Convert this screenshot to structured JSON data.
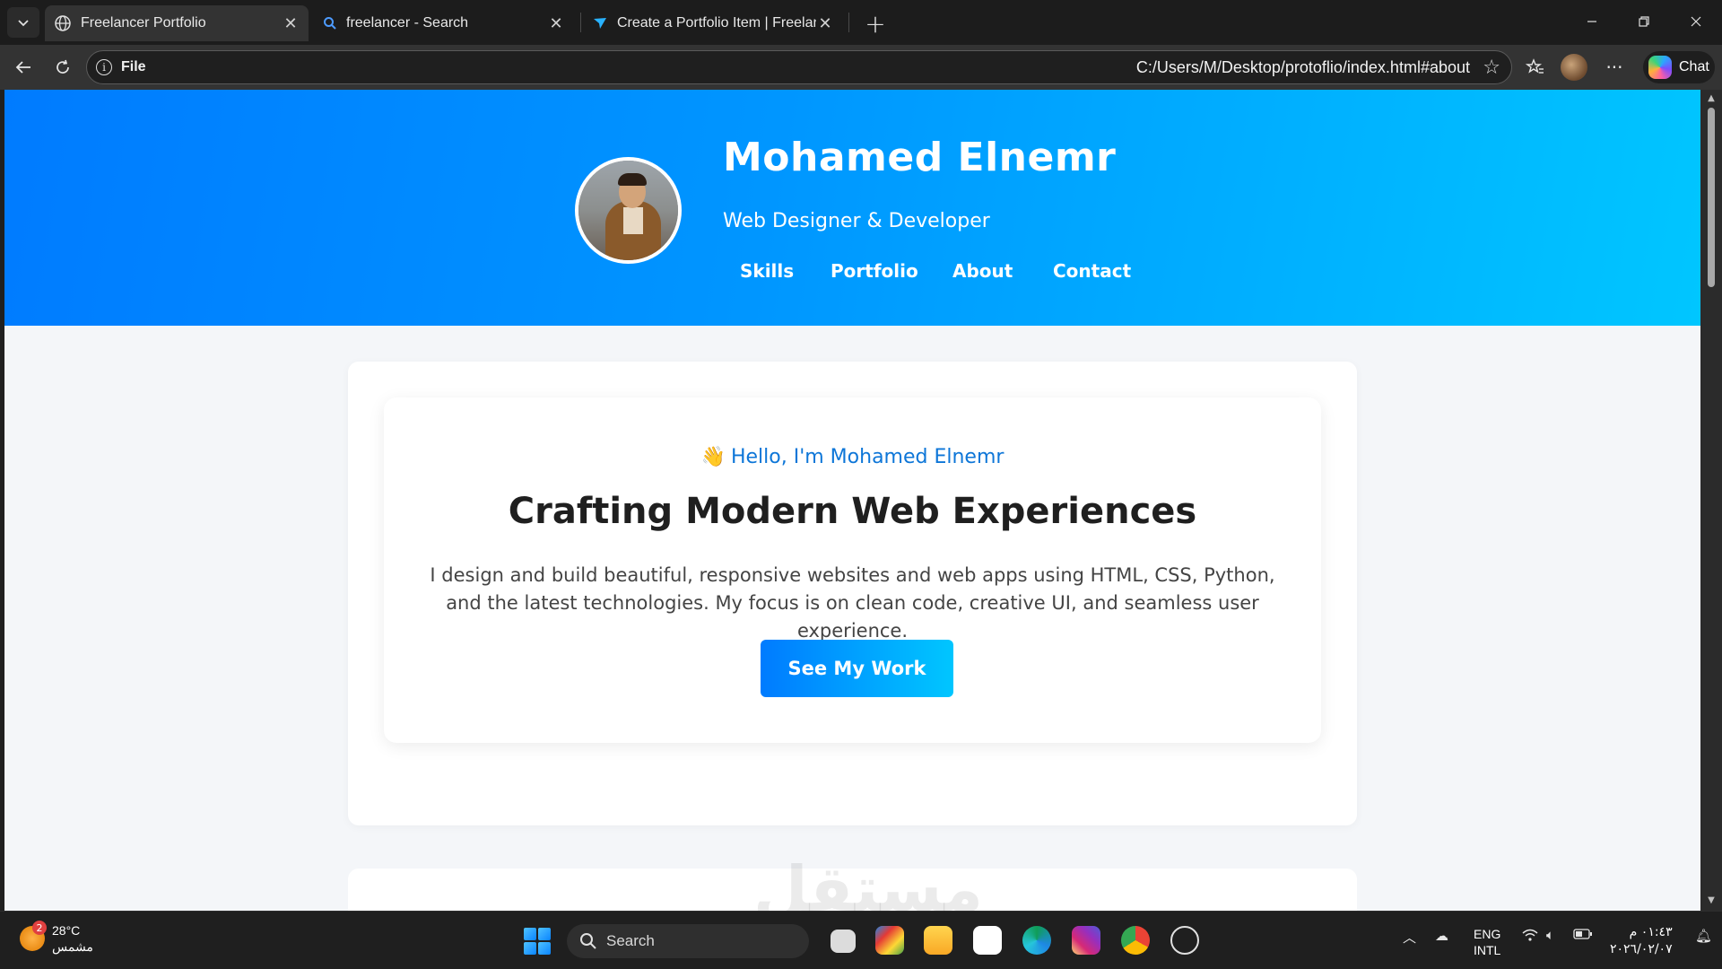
{
  "browser": {
    "tabs": [
      {
        "title": "Freelancer Portfolio",
        "active": true,
        "icon": "globe-icon"
      },
      {
        "title": "freelancer - Search",
        "active": false,
        "icon": "search-icon"
      },
      {
        "title": "Create a Portfolio Item | Freelancer",
        "active": false,
        "icon": "freelancer-logo-icon"
      }
    ],
    "address": {
      "scheme_label": "File",
      "url": "C:/Users/M/Desktop/protoflio/index.html#about"
    },
    "chat_label": "Chat"
  },
  "page": {
    "hero": {
      "name": "Mohamed Elnemr",
      "subtitle": "Web Designer & Developer",
      "nav": [
        "Skills",
        "Portfolio",
        "About",
        "Contact"
      ]
    },
    "intro": {
      "wave_emoji": "👋",
      "greeting": "Hello, I'm Mohamed Elnemr",
      "headline": "Crafting Modern Web Experiences",
      "description": "I design and build beautiful, responsive websites and web apps using HTML, CSS, Python, and the latest technologies. My focus is on clean code, creative UI, and seamless user experience.",
      "cta_label": "See My Work"
    },
    "watermark": "مستقل"
  },
  "taskbar": {
    "weather": {
      "temp": "28°C",
      "condition": "مشمس",
      "badge": "2"
    },
    "search_label": "Search",
    "lang": {
      "line1": "ENG",
      "line2": "INTL"
    },
    "clock": {
      "time": "٠١:٤٣ م",
      "date": "٢٠٢٦/٠٢/٠٧"
    }
  },
  "colors": {
    "hero_start": "#007bff",
    "hero_end": "#00c6ff",
    "accent_text": "#0d76d8"
  }
}
